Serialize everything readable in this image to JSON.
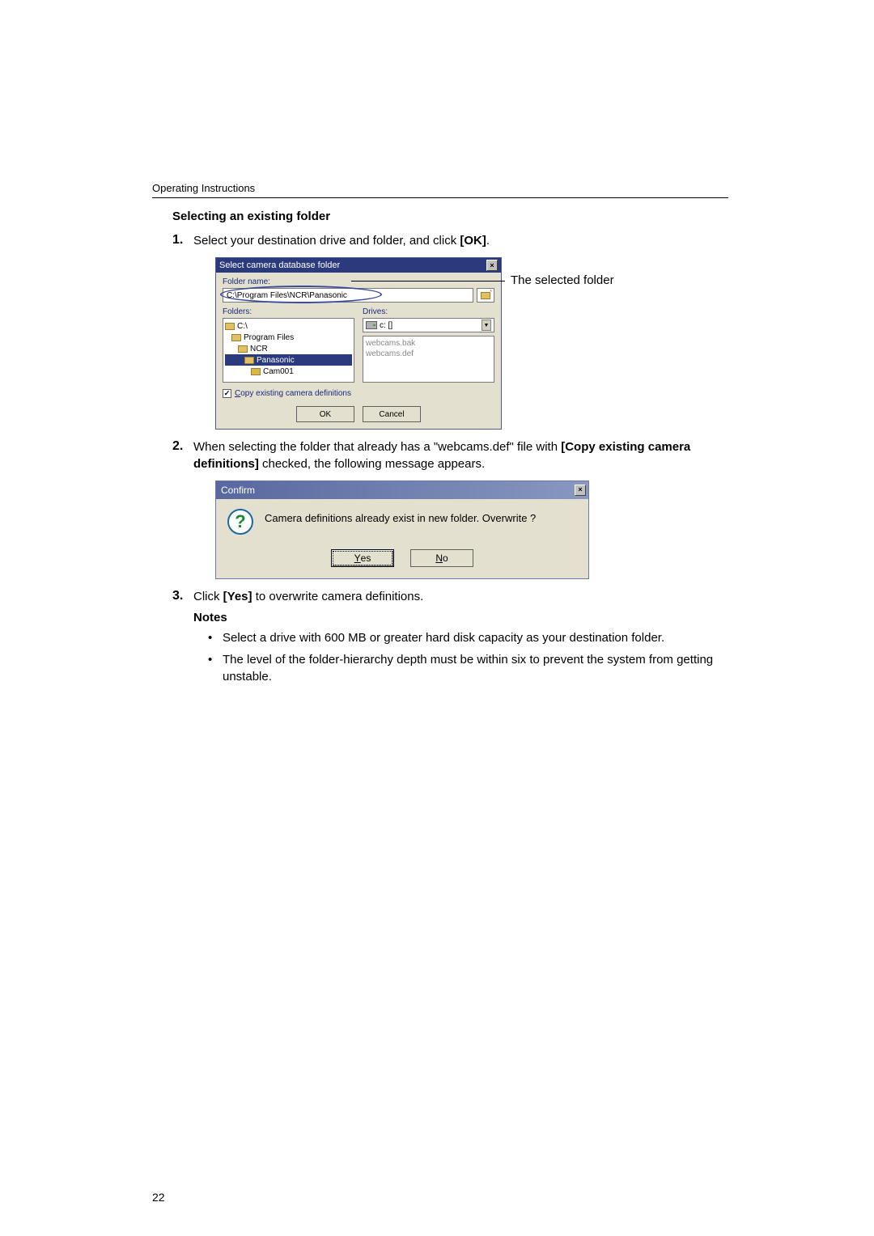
{
  "header": "Operating Instructions",
  "subheading": "Selecting an existing folder",
  "steps": {
    "s1_pre": "Select your destination drive and folder, and click ",
    "s1_bold": "[OK]",
    "s1_post": ".",
    "s2_pre": "When selecting the folder that already has a \"webcams.def\" file with ",
    "s2_bold": "[Copy existing camera definitions]",
    "s2_post": " checked, the following message appears.",
    "s3_pre": "Click ",
    "s3_bold": "[Yes]",
    "s3_post": " to overwrite camera definitions."
  },
  "dialog1": {
    "title": "Select camera database folder",
    "folder_name_label": "Folder name:",
    "folder_path": "C:\\Program Files\\NCR\\Panasonic",
    "folders_label": "Folders:",
    "drives_label": "Drives:",
    "tree": {
      "root": "C:\\",
      "pf": "Program Files",
      "ncr": "NCR",
      "pana": "Panasonic",
      "cam": "Cam001"
    },
    "drive_selected": "c: []",
    "files": {
      "f1": "webcams.bak",
      "f2": "webcams.def"
    },
    "copy_label": "Copy existing camera definitions",
    "ok": "OK",
    "cancel": "Cancel"
  },
  "callout": "The selected folder",
  "confirm": {
    "title": "Confirm",
    "message": "Camera definitions already exist in new folder. Overwrite ?",
    "yes_u": "Y",
    "yes_rest": "es",
    "no_u": "N",
    "no_rest": "o"
  },
  "notes_heading": "Notes",
  "notes": {
    "n1": "Select a drive with 600 MB or greater hard disk capacity as your destination folder.",
    "n2": "The level of the folder-hierarchy depth must be within six to prevent the system from getting unstable."
  },
  "page_number": "22"
}
